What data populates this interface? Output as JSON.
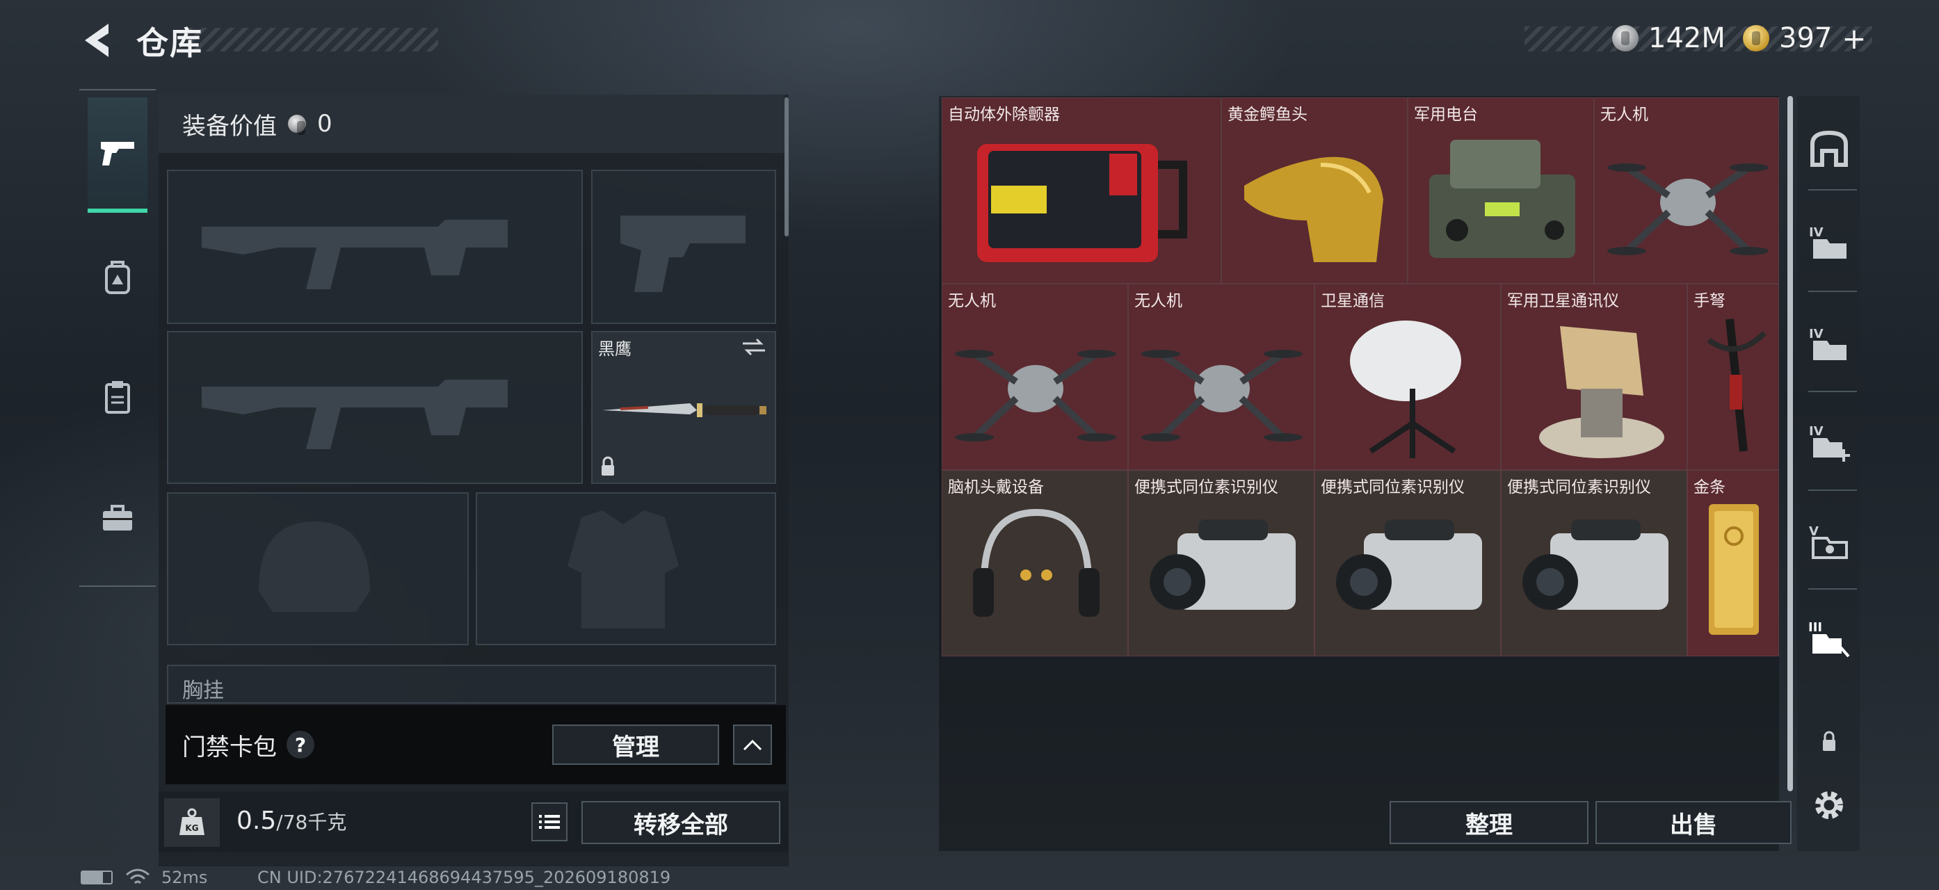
{
  "header": {
    "title": "仓库",
    "currency_silver": "142M",
    "currency_gold": "397"
  },
  "left_tabs": [
    {
      "icon": "pistol-icon",
      "active": true
    },
    {
      "icon": "backpack-icon"
    },
    {
      "icon": "clipboard-icon"
    },
    {
      "icon": "toolbox-icon"
    }
  ],
  "equipment": {
    "value_label": "装备价值",
    "value": "0",
    "knife_name": "黑鹰",
    "chest_label": "胸挂"
  },
  "card_bag": {
    "label": "门禁卡包",
    "help": "?",
    "manage_label": "管理"
  },
  "footer_left": {
    "weight_current": "0.5",
    "weight_max": "/78千克",
    "transfer_all_label": "转移全部"
  },
  "stash": {
    "items": [
      {
        "name": "自动体外除颤器",
        "bg": "red",
        "icon": "defibrillator-icon"
      },
      {
        "name": "黄金鳄鱼头",
        "bg": "red",
        "icon": "gold-crocodile-head-icon"
      },
      {
        "name": "军用电台",
        "bg": "red",
        "icon": "military-radio-icon"
      },
      {
        "name": "无人机",
        "bg": "red",
        "icon": "drone-icon"
      },
      {
        "name": "无人机",
        "bg": "red",
        "icon": "drone-icon"
      },
      {
        "name": "无人机",
        "bg": "red",
        "icon": "drone-icon"
      },
      {
        "name": "卫星通信",
        "bg": "red",
        "icon": "satellite-dish-icon"
      },
      {
        "name": "军用卫星通讯仪",
        "bg": "red",
        "icon": "satellite-array-icon"
      },
      {
        "name": "手弩",
        "bg": "red",
        "icon": "hand-crossbow-icon"
      },
      {
        "name": "脑机头戴设备",
        "bg": "brown",
        "icon": "brain-headset-icon"
      },
      {
        "name": "便携式同位素识别仪",
        "bg": "brown",
        "icon": "isotope-identifier-icon"
      },
      {
        "name": "便携式同位素识别仪",
        "bg": "brown",
        "icon": "isotope-identifier-icon"
      },
      {
        "name": "便携式同位素识别仪",
        "bg": "brown",
        "icon": "isotope-identifier-icon"
      },
      {
        "name": "金条",
        "bg": "red",
        "icon": "gold-bar-icon"
      }
    ],
    "sort_label": "整理",
    "sell_label": "出售"
  },
  "right_rail": [
    {
      "icon": "vault-icon"
    },
    {
      "icon": "folder-iv-icon"
    },
    {
      "icon": "folder-iv-icon"
    },
    {
      "icon": "folder-add-icon"
    },
    {
      "icon": "folder-v-icon"
    },
    {
      "icon": "folder-iii-icon"
    },
    {
      "icon": "lock-icon"
    },
    {
      "icon": "gear-icon"
    }
  ],
  "status_bar": {
    "ping": "52ms",
    "uid": "CN UID:27672241468694437595_202609180819"
  },
  "colors": {
    "accent": "#3fd7a8",
    "item_red": "#5a2a30",
    "item_brown": "#3c3430"
  }
}
